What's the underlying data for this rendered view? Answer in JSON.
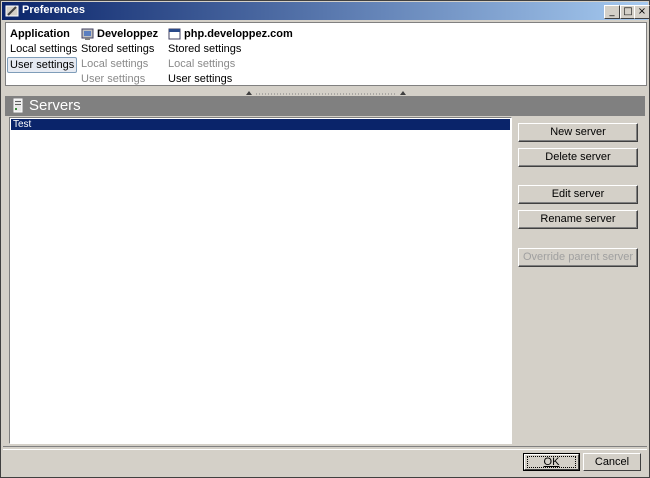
{
  "window": {
    "title": "Preferences"
  },
  "titlebar_buttons": {
    "minimize": "_",
    "maximize": "□",
    "close": "×"
  },
  "nav": {
    "application": {
      "header": "Application",
      "items": [
        {
          "label": "Local settings",
          "state": "normal"
        },
        {
          "label": "User settings",
          "state": "selected"
        }
      ]
    },
    "developpez": {
      "header": "Developpez",
      "icon": "monitor-icon",
      "items": [
        {
          "label": "Stored settings",
          "state": "normal"
        },
        {
          "label": "Local settings",
          "state": "disabled"
        },
        {
          "label": "User settings",
          "state": "disabled"
        }
      ]
    },
    "php_developpez": {
      "header": "php.developpez.com",
      "icon": "window-icon",
      "items": [
        {
          "label": "Stored settings",
          "state": "normal"
        },
        {
          "label": "Local settings",
          "state": "disabled"
        },
        {
          "label": "User settings",
          "state": "normal"
        }
      ]
    }
  },
  "servers": {
    "title": "Servers",
    "icon": "server-icon",
    "list": [
      {
        "name": "Test",
        "selected": true
      }
    ],
    "buttons": {
      "new": "New server",
      "delete": "Delete server",
      "edit": "Edit server",
      "rename": "Rename server",
      "override": "Override parent server"
    }
  },
  "dialog_buttons": {
    "ok": "OK",
    "cancel": "Cancel"
  },
  "colors": {
    "selection": "#0a246a",
    "titlebar_start": "#0a246a",
    "titlebar_end": "#a6caf0",
    "header_bg": "#808080"
  }
}
